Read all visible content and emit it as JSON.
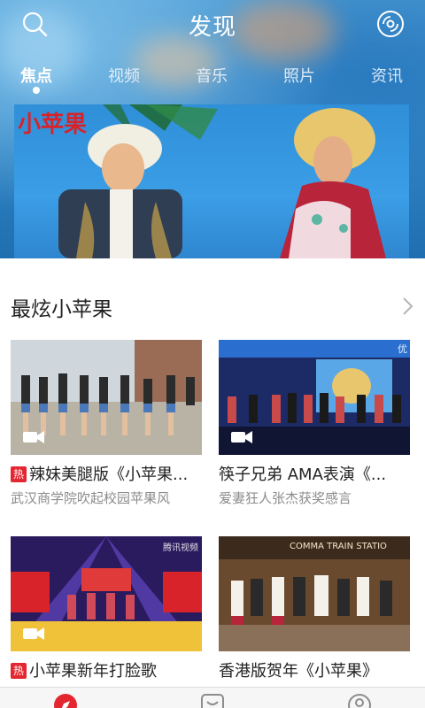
{
  "header": {
    "title": "发现",
    "search_icon": "search-icon",
    "disc_icon": "disc-icon"
  },
  "tabs": [
    {
      "label": "焦点",
      "active": true
    },
    {
      "label": "视频",
      "active": false
    },
    {
      "label": "音乐",
      "active": false
    },
    {
      "label": "照片",
      "active": false
    },
    {
      "label": "资讯",
      "active": false
    }
  ],
  "banner": {
    "overlay_text": "小苹果"
  },
  "section": {
    "title": "最炫小苹果",
    "more_icon": "chevron-right-icon"
  },
  "cards": [
    {
      "hot_badge": "热",
      "title": "辣妹美腿版《小苹果...",
      "subtitle": "武汉商学院吹起校园苹果风",
      "icon": "video-camera-icon"
    },
    {
      "hot_badge": "",
      "title": "筷子兄弟 AMA表演《...",
      "subtitle": "爱妻狂人张杰获奖感言",
      "icon": "video-camera-icon",
      "watermark": "优"
    },
    {
      "hot_badge": "热",
      "title": "小苹果新年打脸歌",
      "subtitle": "",
      "icon": "video-camera-icon",
      "watermark": "腾讯视频"
    },
    {
      "hot_badge": "",
      "title": "香港版贺年《小苹果》",
      "subtitle": "",
      "icon": "",
      "watermark": "COMMA TRAIN STATIO"
    }
  ],
  "colors": {
    "accent_red": "#e3262f",
    "hero_blue": "#2f83c4",
    "text_dark": "#222222",
    "text_gray": "#8c8c8c"
  }
}
